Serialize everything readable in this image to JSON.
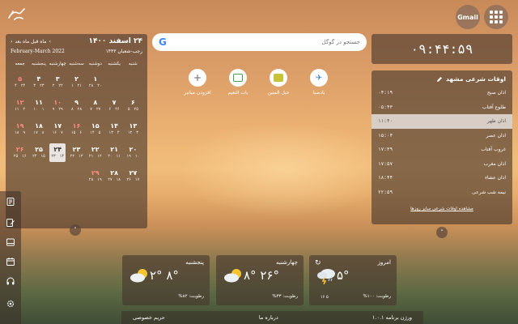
{
  "top": {
    "gmail_label": "Gmail"
  },
  "calendar": {
    "title": "۲۴ اسفند ۱۴۰۰",
    "nav_label": "ماه قبل ماه بعد",
    "hijri": "رجب-شعبان ۱۴۴۳",
    "gregorian": "February-March 2022",
    "weekdays": [
      "شنبه",
      "یکشنبه",
      "دوشنبه",
      "سه‌شنبه",
      "چهارشنبه",
      "پنجشنبه",
      "جمعه"
    ],
    "weeks": [
      [
        {
          "n": "",
          "s": "",
          "g": ""
        },
        {
          "n": "",
          "s": "",
          "g": ""
        },
        {
          "n": "۱",
          "s": "۲۰",
          "g": "۲۸"
        },
        {
          "n": "۲",
          "s": "۲۱",
          "g": "۱"
        },
        {
          "n": "۳",
          "s": "۲۲",
          "g": "۲"
        },
        {
          "n": "۴",
          "s": "۲۳",
          "g": "۳"
        },
        {
          "n": "۵",
          "s": "۲۴",
          "g": "۴",
          "h": true
        }
      ],
      [
        {
          "n": "۶",
          "s": "۲۵",
          "g": "۵"
        },
        {
          "n": "۷",
          "s": "۲۶",
          "g": "۶"
        },
        {
          "n": "۸",
          "s": "۲۷",
          "g": "۷"
        },
        {
          "n": "۹",
          "s": "۲۸",
          "g": "۸"
        },
        {
          "n": "۱۰",
          "s": "۲۹",
          "g": "۹",
          "h": true
        },
        {
          "n": "۱۱",
          "s": "۱",
          "g": "۱۰"
        },
        {
          "n": "۱۲",
          "s": "۲",
          "g": "۱۱",
          "h": true
        }
      ],
      [
        {
          "n": "۱۳",
          "s": "۳",
          "g": "۱۲"
        },
        {
          "n": "۱۴",
          "s": "۴",
          "g": "۱۳"
        },
        {
          "n": "۱۵",
          "s": "۵",
          "g": "۱۴"
        },
        {
          "n": "۱۶",
          "s": "۶",
          "g": "۱۵",
          "h": true
        },
        {
          "n": "۱۷",
          "s": "۷",
          "g": "۱۶"
        },
        {
          "n": "۱۸",
          "s": "۸",
          "g": "۱۷"
        },
        {
          "n": "۱۹",
          "s": "۹",
          "g": "۱۸",
          "h": true
        }
      ],
      [
        {
          "n": "۲۰",
          "s": "۱۰",
          "g": "۱۹"
        },
        {
          "n": "۲۱",
          "s": "۱۱",
          "g": "۲۰"
        },
        {
          "n": "۲۲",
          "s": "۱۲",
          "g": "۲۱"
        },
        {
          "n": "۲۳",
          "s": "۱۳",
          "g": "۲۲"
        },
        {
          "n": "۲۴",
          "s": "۱۴",
          "g": "۲۳",
          "t": true
        },
        {
          "n": "۲۵",
          "s": "۱۵",
          "g": "۲۴"
        },
        {
          "n": "۲۶",
          "s": "۱۶",
          "g": "۲۵",
          "h": true
        }
      ],
      [
        {
          "n": "۲۷",
          "s": "۱۷",
          "g": "۲۶"
        },
        {
          "n": "۲۸",
          "s": "۱۸",
          "g": "۲۷"
        },
        {
          "n": "۲۹",
          "s": "۱۹",
          "g": "۲۸",
          "h": true
        },
        {
          "n": "",
          "s": "",
          "g": ""
        },
        {
          "n": "",
          "s": "",
          "g": ""
        },
        {
          "n": "",
          "s": "",
          "g": ""
        },
        {
          "n": "",
          "s": "",
          "g": ""
        }
      ]
    ]
  },
  "search": {
    "placeholder": "جستجو در گوگل"
  },
  "shortcuts": [
    {
      "label": "بادصبا",
      "icon": "badsaba-icon"
    },
    {
      "label": "حبل المتین",
      "icon": "hablolmatin-icon"
    },
    {
      "label": "باب النعیم",
      "icon": "babonaeim-icon"
    },
    {
      "label": "افزودن میانبر",
      "icon": "plus-icon"
    }
  ],
  "clock": {
    "time": "۰۹:۴۴:۵۹"
  },
  "prayer": {
    "title": "اوقات شرعی مشهد",
    "rows": [
      {
        "name": "اذان صبح",
        "time": "۰۴:۱۹"
      },
      {
        "name": "طلوع آفتاب",
        "time": "۰۵:۴۳"
      },
      {
        "name": "اذان ظهر",
        "time": "۱۱:۴۰",
        "active": true
      },
      {
        "name": "اذان عصر",
        "time": "۱۵:۰۴"
      },
      {
        "name": "غروب آفتاب",
        "time": "۱۷:۳۹"
      },
      {
        "name": "اذان مغرب",
        "time": "۱۷:۵۷"
      },
      {
        "name": "اذان عشاء",
        "time": "۱۸:۴۴"
      },
      {
        "name": "نیمه شب شرعی",
        "time": "۲۲:۵۹"
      }
    ],
    "more_link": "مشاهده اوقات شرعی سایر روزها"
  },
  "weather": [
    {
      "day": "امروز",
      "temps": "۵°",
      "humidity": "رطوبت: ۱۰۰%",
      "icon": "storm-cloud-icon",
      "extra": "۵    ۱۶",
      "today": true
    },
    {
      "day": "چهارشنبه",
      "temps": "۸° ۲۶°",
      "humidity": "رطوبت: ۳۳%",
      "icon": "partly-cloudy-icon"
    },
    {
      "day": "پنجشنبه",
      "temps": "۲° ۸°",
      "humidity": "رطوبت: ۸۲%",
      "icon": "partly-cloudy-icon"
    }
  ],
  "footer": {
    "version": "ورژن برنامه ۱.۰.۱",
    "about": "درباره ما",
    "privacy": "حریم خصوصی"
  }
}
